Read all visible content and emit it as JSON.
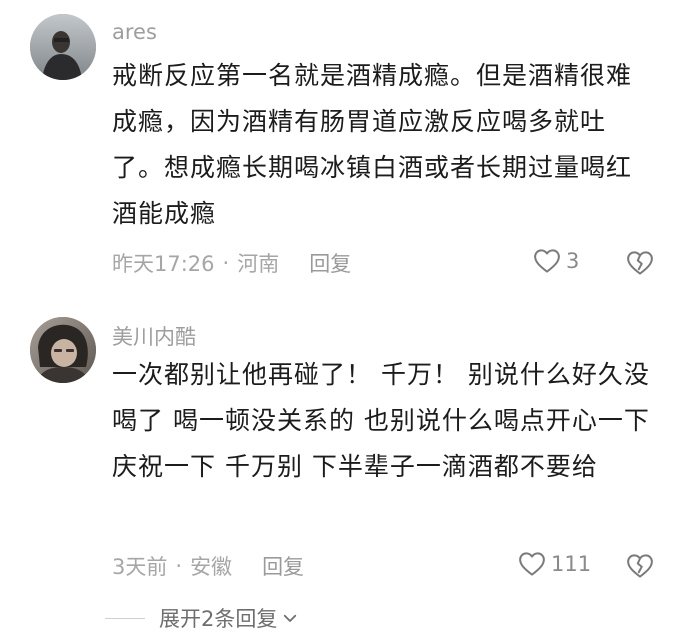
{
  "comments": [
    {
      "username": "ares",
      "text": "戒断反应第一名就是酒精成瘾。但是酒精很难成瘾，因为酒精有肠胃道应激反应喝多就吐了。想成瘾长期喝冰镇白酒或者长期过量喝红酒能成瘾",
      "time": "昨天17:26",
      "separator": "·",
      "location": "河南",
      "reply_label": "回复",
      "like_count": "3",
      "avatar_icon": "user-avatar",
      "like_icon": "heart-outline-icon",
      "dislike_icon": "broken-heart-icon"
    },
    {
      "username": "美川内酷",
      "text": "一次都别让他再碰了！ 千万！ 别说什么好久没喝了 喝一顿没关系的 也别说什么喝点开心一下庆祝一下 千万别 下半辈子一滴酒都不要给",
      "time": "3天前",
      "separator": "·",
      "location": "安徽",
      "reply_label": "回复",
      "like_count": "111",
      "avatar_icon": "user-avatar",
      "like_icon": "heart-outline-icon",
      "dislike_icon": "broken-heart-icon"
    }
  ],
  "expand_replies": {
    "label": "展开2条回复",
    "icon": "chevron-down-icon"
  },
  "colors": {
    "text_primary": "#1c1c1c",
    "text_secondary": "#a6a6a6",
    "background": "#ffffff"
  }
}
